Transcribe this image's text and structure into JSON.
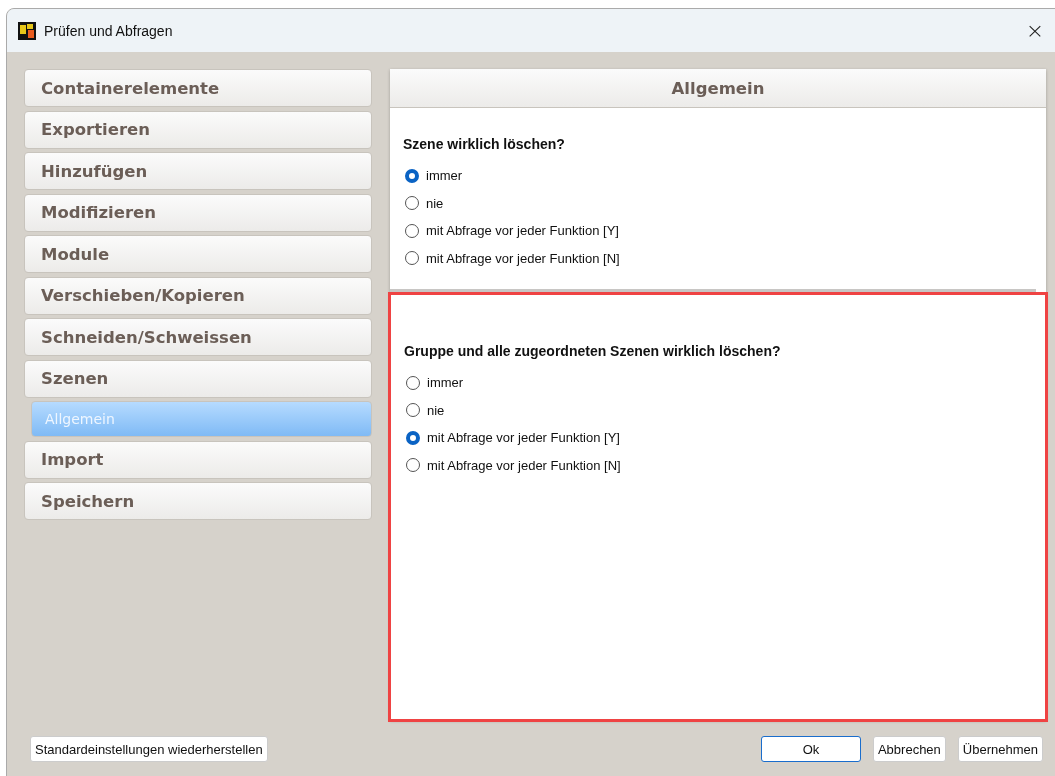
{
  "window": {
    "title": "Prüfen und Abfragen",
    "close": "×"
  },
  "sidebar": {
    "items": [
      {
        "label": "Containerelemente",
        "selected": false
      },
      {
        "label": "Exportieren",
        "selected": false
      },
      {
        "label": "Hinzufügen",
        "selected": false
      },
      {
        "label": "Modifizieren",
        "selected": false
      },
      {
        "label": "Module",
        "selected": false
      },
      {
        "label": "Verschieben/Kopieren",
        "selected": false
      },
      {
        "label": "Schneiden/Schweissen",
        "selected": false
      },
      {
        "label": "Szenen",
        "selected": false,
        "children": [
          {
            "label": "Allgemein",
            "selected": true
          }
        ]
      },
      {
        "label": "Import",
        "selected": false
      },
      {
        "label": "Speichern",
        "selected": false
      }
    ]
  },
  "panel": {
    "title": "Allgemein",
    "sections": [
      {
        "question": "Szene wirklich löschen?",
        "highlighted": false,
        "options": [
          {
            "label": "immer",
            "selected": true
          },
          {
            "label": "nie",
            "selected": false
          },
          {
            "label": "mit Abfrage vor jeder Funktion [Y]",
            "selected": false
          },
          {
            "label": "mit Abfrage vor jeder Funktion [N]",
            "selected": false
          }
        ]
      },
      {
        "question": "Gruppe und alle zugeordneten Szenen wirklich löschen?",
        "highlighted": true,
        "options": [
          {
            "label": "immer",
            "selected": false
          },
          {
            "label": "nie",
            "selected": false
          },
          {
            "label": "mit Abfrage vor jeder Funktion [Y]",
            "selected": true
          },
          {
            "label": "mit Abfrage vor jeder Funktion [N]",
            "selected": false
          }
        ]
      }
    ]
  },
  "buttons": {
    "restore": "Standardeinstellungen wiederherstellen",
    "ok": "Ok",
    "cancel": "Abbrechen",
    "apply": "Übernehmen"
  }
}
